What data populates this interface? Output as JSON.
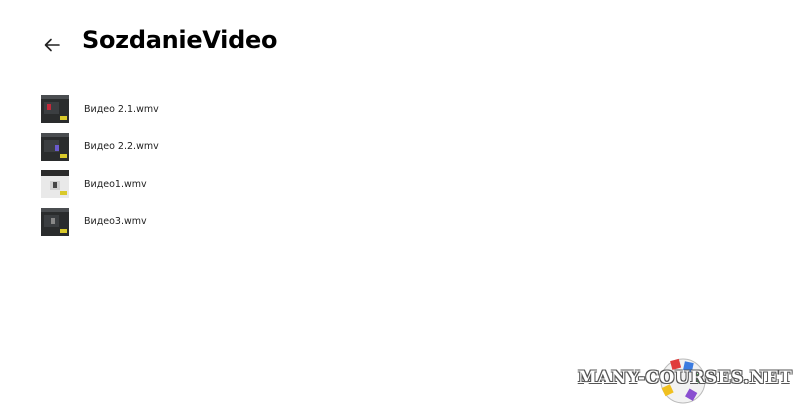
{
  "header": {
    "back_icon": "arrow-left-icon",
    "title": "SozdanieVideo"
  },
  "files": [
    {
      "name": "Видео 2.1.wmv",
      "thumb_style": "dark",
      "accent": "#c4283a"
    },
    {
      "name": "Видео 2.2.wmv",
      "thumb_style": "dark",
      "accent": "#6a5acd"
    },
    {
      "name": "Видео1.wmv",
      "thumb_style": "light",
      "accent": "#444444"
    },
    {
      "name": "Видео3.wmv",
      "thumb_style": "dark",
      "accent": "#888888"
    }
  ],
  "watermark": {
    "text": "MANY-COURSES.NET",
    "colors": [
      "#e03b3b",
      "#3b7be0",
      "#3bb04a",
      "#f0c020",
      "#8a4fd0"
    ]
  }
}
